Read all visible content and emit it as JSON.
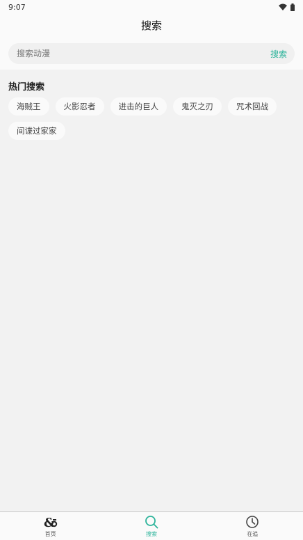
{
  "status_bar": {
    "time": "9:07",
    "icons": [
      "wifi-icon",
      "battery-icon"
    ]
  },
  "header": {
    "title": "搜索"
  },
  "search": {
    "placeholder": "搜索动漫",
    "value": "",
    "submit_label": "搜索"
  },
  "hot_search": {
    "title": "热门搜索",
    "tags": [
      "海贼王",
      "火影忍者",
      "进击的巨人",
      "鬼灭之刃",
      "咒术回战",
      "间谍过家家"
    ]
  },
  "bottom_nav": {
    "items": [
      {
        "label": "首页",
        "icon": "home-logo-icon",
        "active": false
      },
      {
        "label": "搜索",
        "icon": "search-icon",
        "active": true
      },
      {
        "label": "在追",
        "icon": "clock-icon",
        "active": false
      }
    ]
  },
  "colors": {
    "accent": "#2bb39a",
    "background": "#f2f2f2",
    "surface": "#fafafa"
  }
}
